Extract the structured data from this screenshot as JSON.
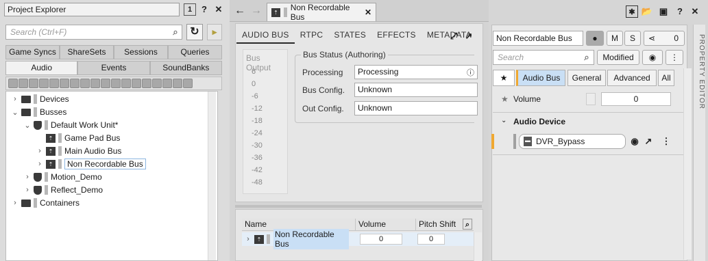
{
  "explorer": {
    "title": "Project Explorer",
    "badge": "1",
    "search_placeholder": "Search (Ctrl+F)",
    "tabs_row1": [
      "Game Syncs",
      "ShareSets",
      "Sessions",
      "Queries"
    ],
    "tabs_row2": [
      "Audio",
      "Events",
      "SoundBanks"
    ],
    "tree": [
      {
        "label": "Devices"
      },
      {
        "label": "Busses"
      },
      {
        "label": "Default Work Unit*"
      },
      {
        "label": "Game Pad Bus"
      },
      {
        "label": "Main Audio Bus"
      },
      {
        "label": "Non Recordable Bus"
      },
      {
        "label": "Motion_Demo"
      },
      {
        "label": "Reflect_Demo"
      },
      {
        "label": "Containers"
      }
    ]
  },
  "editor": {
    "doc_tab": "Non Recordable Bus",
    "subtabs": [
      "AUDIO BUS",
      "RTPC",
      "STATES",
      "EFFECTS",
      "METADATA"
    ],
    "meter_title": "Bus Output",
    "meter_ticks": [
      "6",
      "0",
      "-6",
      "-12",
      "-18",
      "-24",
      "-30",
      "-36",
      "-42",
      "-48"
    ],
    "status_group": "Bus Status (Authoring)",
    "processing_label": "Processing",
    "processing_value": "Processing",
    "bus_config_label": "Bus Config.",
    "bus_config_value": "Unknown",
    "out_config_label": "Out Config.",
    "out_config_value": "Unknown",
    "list_cols": [
      "Name",
      "Volume",
      "Pitch Shift"
    ],
    "list_row_name": "Non Recordable Bus",
    "list_row_volume": "0",
    "list_row_pitch": "0"
  },
  "props": {
    "name": "Non Recordable Bus",
    "m_label": "M",
    "s_label": "S",
    "share_count": "0",
    "search_placeholder": "Search",
    "modified_label": "Modified",
    "star": "★",
    "tabs": [
      "Audio Bus",
      "General",
      "Advanced",
      "All"
    ],
    "volume_label": "Volume",
    "volume_value": "0",
    "audio_device_heading": "Audio Device",
    "audio_device_value": "DVR_Bypass",
    "side_label": "PROPERTY EDITOR",
    "accent": "#f0a830",
    "selected_tab_color": "#c9dff5"
  }
}
